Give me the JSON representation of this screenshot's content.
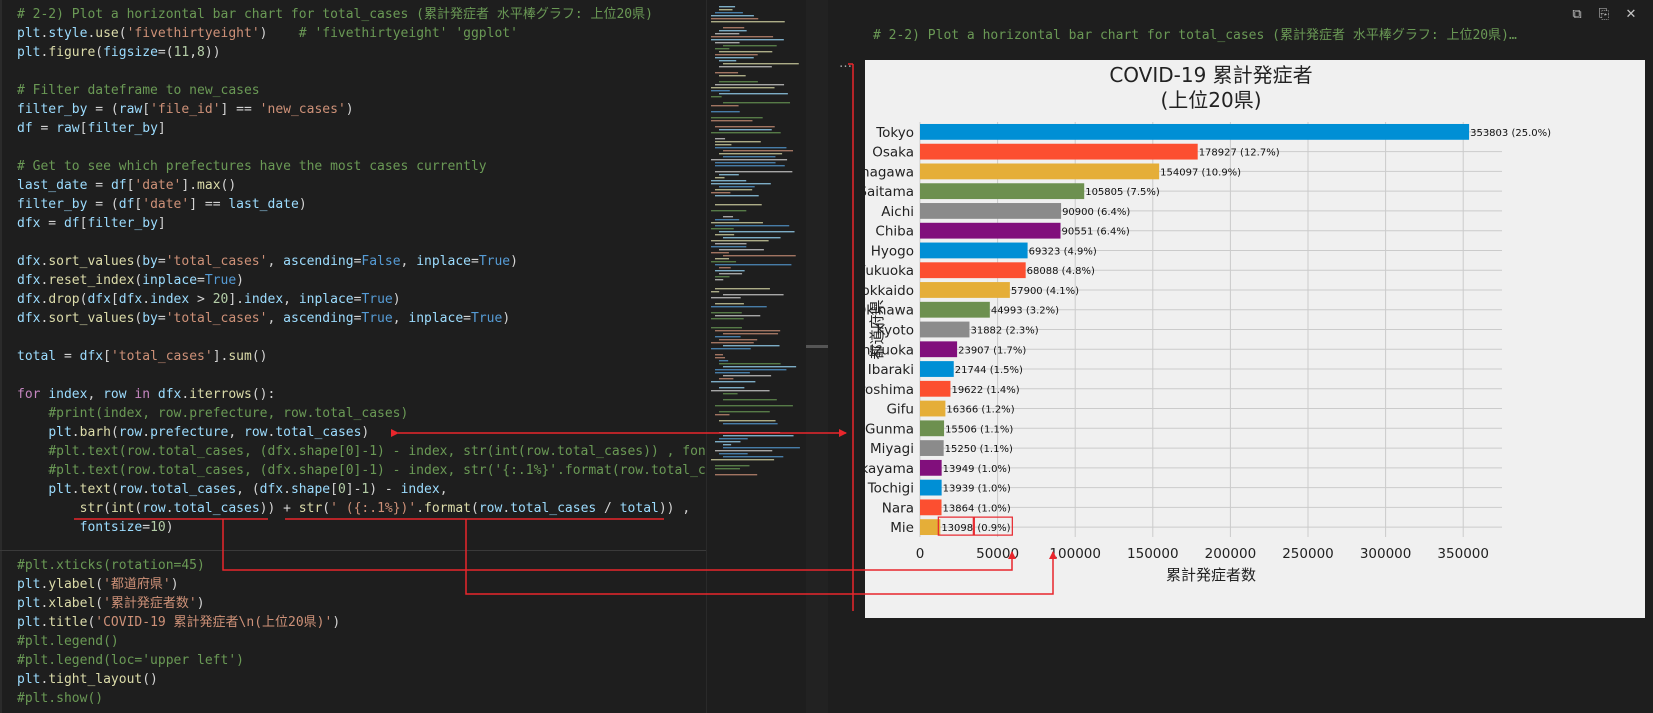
{
  "editor": {
    "lines": [
      [
        [
          "cm",
          "# 2-2) Plot a horizontal bar chart for total_cases (累計発症者 水平棒グラフ: 上位20県)"
        ]
      ],
      [
        [
          "id",
          "plt"
        ],
        [
          "tx",
          "."
        ],
        [
          "id",
          "style"
        ],
        [
          "tx",
          "."
        ],
        [
          "fn",
          "use"
        ],
        [
          "tx",
          "("
        ],
        [
          "st",
          "'fivethirtyeight'"
        ],
        [
          "tx",
          ")    "
        ],
        [
          "cm",
          "# 'fivethirtyeight' 'ggplot'"
        ]
      ],
      [
        [
          "id",
          "plt"
        ],
        [
          "tx",
          "."
        ],
        [
          "fn",
          "figure"
        ],
        [
          "tx",
          "("
        ],
        [
          "id",
          "figsize"
        ],
        [
          "tx",
          "=("
        ],
        [
          "nu",
          "11"
        ],
        [
          "tx",
          ","
        ],
        [
          "nu",
          "8"
        ],
        [
          "tx",
          "))"
        ]
      ],
      [
        [
          "tx",
          ""
        ]
      ],
      [
        [
          "cm",
          "# Filter dateframe to new_cases"
        ]
      ],
      [
        [
          "id",
          "filter_by"
        ],
        [
          "tx",
          " = ("
        ],
        [
          "id",
          "raw"
        ],
        [
          "tx",
          "["
        ],
        [
          "st",
          "'file_id'"
        ],
        [
          "tx",
          "] == "
        ],
        [
          "st",
          "'new_cases'"
        ],
        [
          "tx",
          ")"
        ]
      ],
      [
        [
          "id",
          "df"
        ],
        [
          "tx",
          " = "
        ],
        [
          "id",
          "raw"
        ],
        [
          "tx",
          "["
        ],
        [
          "id",
          "filter_by"
        ],
        [
          "tx",
          "]"
        ]
      ],
      [
        [
          "tx",
          ""
        ]
      ],
      [
        [
          "cm",
          "# Get to see which prefectures have the most cases currently"
        ]
      ],
      [
        [
          "id",
          "last_date"
        ],
        [
          "tx",
          " = "
        ],
        [
          "id",
          "df"
        ],
        [
          "tx",
          "["
        ],
        [
          "st",
          "'date'"
        ],
        [
          "tx",
          "]."
        ],
        [
          "fn",
          "max"
        ],
        [
          "tx",
          "()"
        ]
      ],
      [
        [
          "id",
          "filter_by"
        ],
        [
          "tx",
          " = ("
        ],
        [
          "id",
          "df"
        ],
        [
          "tx",
          "["
        ],
        [
          "st",
          "'date'"
        ],
        [
          "tx",
          "] == "
        ],
        [
          "id",
          "last_date"
        ],
        [
          "tx",
          ")"
        ]
      ],
      [
        [
          "id",
          "dfx"
        ],
        [
          "tx",
          " = "
        ],
        [
          "id",
          "df"
        ],
        [
          "tx",
          "["
        ],
        [
          "id",
          "filter_by"
        ],
        [
          "tx",
          "]"
        ]
      ],
      [
        [
          "tx",
          ""
        ]
      ],
      [
        [
          "id",
          "dfx"
        ],
        [
          "tx",
          "."
        ],
        [
          "fn",
          "sort_values"
        ],
        [
          "tx",
          "("
        ],
        [
          "id",
          "by"
        ],
        [
          "tx",
          "="
        ],
        [
          "st",
          "'total_cases'"
        ],
        [
          "tx",
          ", "
        ],
        [
          "id",
          "ascending"
        ],
        [
          "tx",
          "="
        ],
        [
          "kw",
          "False"
        ],
        [
          "tx",
          ", "
        ],
        [
          "id",
          "inplace"
        ],
        [
          "tx",
          "="
        ],
        [
          "kw",
          "True"
        ],
        [
          "tx",
          ")"
        ]
      ],
      [
        [
          "id",
          "dfx"
        ],
        [
          "tx",
          "."
        ],
        [
          "fn",
          "reset_index"
        ],
        [
          "tx",
          "("
        ],
        [
          "id",
          "inplace"
        ],
        [
          "tx",
          "="
        ],
        [
          "kw",
          "True"
        ],
        [
          "tx",
          ")"
        ]
      ],
      [
        [
          "id",
          "dfx"
        ],
        [
          "tx",
          "."
        ],
        [
          "fn",
          "drop"
        ],
        [
          "tx",
          "("
        ],
        [
          "id",
          "dfx"
        ],
        [
          "tx",
          "["
        ],
        [
          "id",
          "dfx"
        ],
        [
          "tx",
          "."
        ],
        [
          "id",
          "index"
        ],
        [
          "tx",
          " > "
        ],
        [
          "nu",
          "20"
        ],
        [
          "tx",
          "]."
        ],
        [
          "id",
          "index"
        ],
        [
          "tx",
          ", "
        ],
        [
          "id",
          "inplace"
        ],
        [
          "tx",
          "="
        ],
        [
          "kw",
          "True"
        ],
        [
          "tx",
          ")"
        ]
      ],
      [
        [
          "id",
          "dfx"
        ],
        [
          "tx",
          "."
        ],
        [
          "fn",
          "sort_values"
        ],
        [
          "tx",
          "("
        ],
        [
          "id",
          "by"
        ],
        [
          "tx",
          "="
        ],
        [
          "st",
          "'total_cases'"
        ],
        [
          "tx",
          ", "
        ],
        [
          "id",
          "ascending"
        ],
        [
          "tx",
          "="
        ],
        [
          "kw",
          "True"
        ],
        [
          "tx",
          ", "
        ],
        [
          "id",
          "inplace"
        ],
        [
          "tx",
          "="
        ],
        [
          "kw",
          "True"
        ],
        [
          "tx",
          ")"
        ]
      ],
      [
        [
          "tx",
          ""
        ]
      ],
      [
        [
          "id",
          "total"
        ],
        [
          "tx",
          " = "
        ],
        [
          "id",
          "dfx"
        ],
        [
          "tx",
          "["
        ],
        [
          "st",
          "'total_cases'"
        ],
        [
          "tx",
          "]."
        ],
        [
          "fn",
          "sum"
        ],
        [
          "tx",
          "()"
        ]
      ],
      [
        [
          "tx",
          ""
        ]
      ],
      [
        [
          "ct",
          "for"
        ],
        [
          "tx",
          " "
        ],
        [
          "id",
          "index"
        ],
        [
          "tx",
          ", "
        ],
        [
          "id",
          "row"
        ],
        [
          "tx",
          " "
        ],
        [
          "ct",
          "in"
        ],
        [
          "tx",
          " "
        ],
        [
          "id",
          "dfx"
        ],
        [
          "tx",
          "."
        ],
        [
          "fn",
          "iterrows"
        ],
        [
          "tx",
          "():"
        ]
      ],
      [
        [
          "tx",
          "    "
        ],
        [
          "cm",
          "#print(index, row.prefecture, row.total_cases)"
        ]
      ],
      [
        [
          "tx",
          "    "
        ],
        [
          "id",
          "plt"
        ],
        [
          "tx",
          "."
        ],
        [
          "fn",
          "barh"
        ],
        [
          "tx",
          "("
        ],
        [
          "id",
          "row"
        ],
        [
          "tx",
          "."
        ],
        [
          "id",
          "prefecture"
        ],
        [
          "tx",
          ", "
        ],
        [
          "id",
          "row"
        ],
        [
          "tx",
          "."
        ],
        [
          "id",
          "total_cases"
        ],
        [
          "tx",
          ")"
        ]
      ],
      [
        [
          "tx",
          "    "
        ],
        [
          "cm",
          "#plt.text(row.total_cases, (dfx.shape[0]-1) - index, str(int(row.total_cases)) , fonts"
        ]
      ],
      [
        [
          "tx",
          "    "
        ],
        [
          "cm",
          "#plt.text(row.total_cases, (dfx.shape[0]-1) - index, str('{:.1%}'.format(row.total_cas"
        ]
      ],
      [
        [
          "tx",
          "    "
        ],
        [
          "id",
          "plt"
        ],
        [
          "tx",
          "."
        ],
        [
          "fn",
          "text"
        ],
        [
          "tx",
          "("
        ],
        [
          "id",
          "row"
        ],
        [
          "tx",
          "."
        ],
        [
          "id",
          "total_cases"
        ],
        [
          "tx",
          ", ("
        ],
        [
          "id",
          "dfx"
        ],
        [
          "tx",
          "."
        ],
        [
          "id",
          "shape"
        ],
        [
          "tx",
          "["
        ],
        [
          "nu",
          "0"
        ],
        [
          "tx",
          "]-"
        ],
        [
          "nu",
          "1"
        ],
        [
          "tx",
          ") - "
        ],
        [
          "id",
          "index"
        ],
        [
          "tx",
          ","
        ]
      ],
      [
        [
          "tx",
          "        "
        ],
        [
          "fn",
          "str"
        ],
        [
          "tx",
          "("
        ],
        [
          "fn",
          "int"
        ],
        [
          "tx",
          "("
        ],
        [
          "id",
          "row"
        ],
        [
          "tx",
          "."
        ],
        [
          "id",
          "total_cases"
        ],
        [
          "tx",
          ")) + "
        ],
        [
          "fn",
          "str"
        ],
        [
          "tx",
          "("
        ],
        [
          "st",
          "' ({:.1%})'"
        ],
        [
          "tx",
          "."
        ],
        [
          "fn",
          "format"
        ],
        [
          "tx",
          "("
        ],
        [
          "id",
          "row"
        ],
        [
          "tx",
          "."
        ],
        [
          "id",
          "total_cases"
        ],
        [
          "tx",
          " / "
        ],
        [
          "id",
          "total"
        ],
        [
          "tx",
          ")) ,"
        ]
      ],
      [
        [
          "tx",
          "        "
        ],
        [
          "id",
          "fontsize"
        ],
        [
          "tx",
          "="
        ],
        [
          "nu",
          "10"
        ],
        [
          "tx",
          ")"
        ]
      ],
      [
        [
          "tx",
          ""
        ]
      ],
      [
        [
          "cm",
          "#plt.xticks(rotation=45)"
        ]
      ],
      [
        [
          "id",
          "plt"
        ],
        [
          "tx",
          "."
        ],
        [
          "fn",
          "ylabel"
        ],
        [
          "tx",
          "("
        ],
        [
          "st",
          "'都道府県'"
        ],
        [
          "tx",
          ")"
        ]
      ],
      [
        [
          "id",
          "plt"
        ],
        [
          "tx",
          "."
        ],
        [
          "fn",
          "xlabel"
        ],
        [
          "tx",
          "("
        ],
        [
          "st",
          "'累計発症者数'"
        ],
        [
          "tx",
          ")"
        ]
      ],
      [
        [
          "id",
          "plt"
        ],
        [
          "tx",
          "."
        ],
        [
          "fn",
          "title"
        ],
        [
          "tx",
          "("
        ],
        [
          "st",
          "'COVID-19 累計発症者\\n(上位20県)'"
        ],
        [
          "tx",
          ")"
        ]
      ],
      [
        [
          "cm",
          "#plt.legend()"
        ]
      ],
      [
        [
          "cm",
          "#plt.legend(loc='upper left')"
        ]
      ],
      [
        [
          "id",
          "plt"
        ],
        [
          "tx",
          "."
        ],
        [
          "fn",
          "tight_layout"
        ],
        [
          "tx",
          "()"
        ]
      ],
      [
        [
          "cm",
          "#plt.show()"
        ]
      ]
    ]
  },
  "output": {
    "header": "# 2-2) Plot a horizontal bar chart for total_cases (累計発症者 水平棒グラフ: 上位20県)…",
    "menu_glyph": "…"
  },
  "toolbar": {
    "copy_icon": "copy-icon",
    "expand_icon": "open-in-new-icon",
    "close_icon": "close-icon"
  },
  "colors": {
    "code_bg": "#1e1e1e",
    "figure_bg": "#f0f0f0",
    "annotation_red": "#e8262c",
    "bar_palette": [
      "#e5ae38",
      "#fc4f30",
      "#008fd5",
      "#810f7c",
      "#8b8b8b",
      "#6d904f"
    ]
  },
  "chart_data": {
    "type": "bar",
    "orientation": "horizontal",
    "title": "COVID-19 累計発症者\n(上位20県)",
    "xlabel": "累計発症者数",
    "ylabel": "都道府県",
    "xlim": [
      0,
      375000
    ],
    "xticks": [
      0,
      50000,
      100000,
      150000,
      200000,
      250000,
      300000,
      350000
    ],
    "grid": true,
    "categories": [
      "Tokyo",
      "Osaka",
      "Kanagawa",
      "Saitama",
      "Aichi",
      "Chiba",
      "Hyogo",
      "Fukuoka",
      "Hokkaido",
      "Okinawa",
      "Kyoto",
      "Shizuoka",
      "Ibaraki",
      "Hiroshima",
      "Gifu",
      "Gunma",
      "Miyagi",
      "Okayama",
      "Tochigi",
      "Nara",
      "Mie"
    ],
    "values": [
      353803,
      178927,
      154097,
      105805,
      90900,
      90551,
      69323,
      68088,
      57900,
      44993,
      31882,
      23907,
      21744,
      19622,
      16366,
      15506,
      15250,
      13949,
      13939,
      13864,
      13098
    ],
    "labels": [
      "353803 (25.0%)",
      "178927 (12.7%)",
      "154097 (10.9%)",
      "105805 (7.5%)",
      "90900 (6.4%)",
      "90551 (6.4%)",
      "69323 (4.9%)",
      "68088 (4.8%)",
      "57900 (4.1%)",
      "44993 (3.2%)",
      "31882 (2.3%)",
      "23907 (1.7%)",
      "21744 (1.5%)",
      "19622 (1.4%)",
      "16366 (1.2%)",
      "15506 (1.1%)",
      "15250 (1.1%)",
      "13949 (1.0%)",
      "13939 (1.0%)",
      "13864 (1.0%)",
      "13098 (0.9%)"
    ],
    "mie_value_label": "13098",
    "mie_percent_label": "(0.9%)"
  }
}
